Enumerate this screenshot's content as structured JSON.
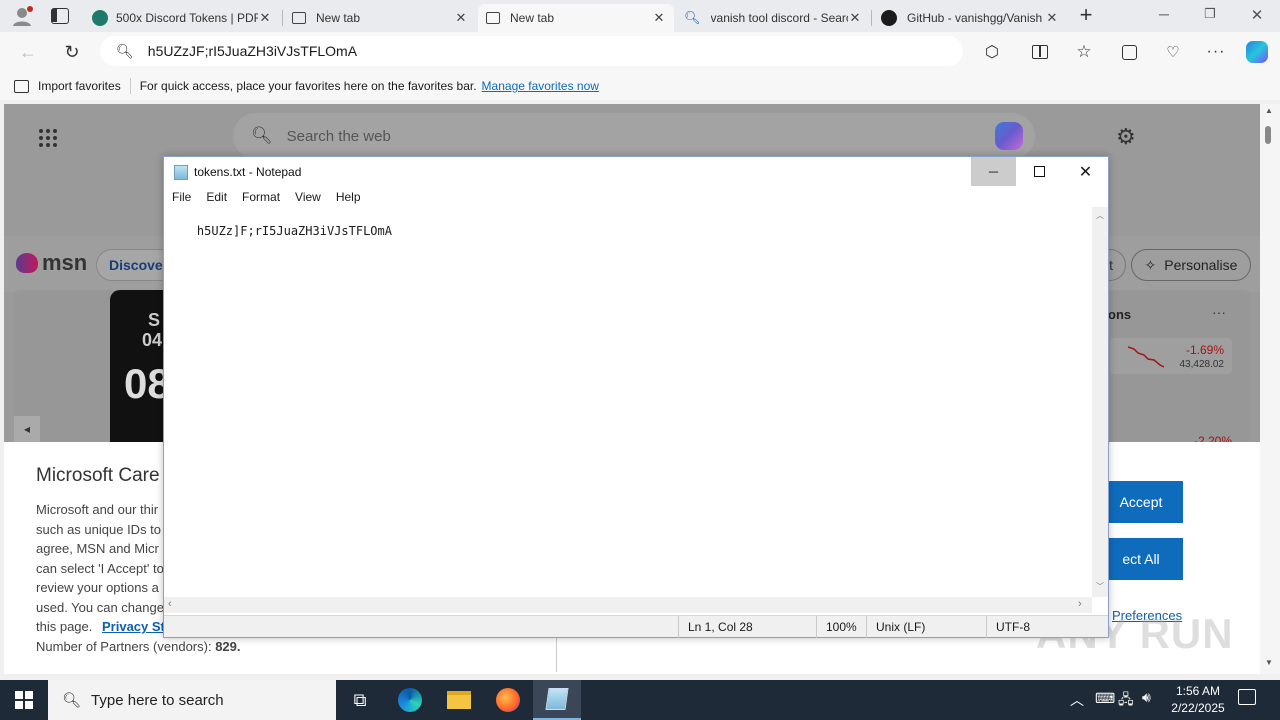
{
  "browser": {
    "tabs": [
      {
        "title": "500x Discord Tokens | PDF",
        "icon": "globe-icon"
      },
      {
        "title": "New tab",
        "icon": "newtab-icon"
      },
      {
        "title": "New tab",
        "icon": "newtab-icon"
      },
      {
        "title": "vanish tool discord - Search",
        "icon": "search-icon"
      },
      {
        "title": "GitHub - vanishgg/Vanish",
        "icon": "github-icon"
      }
    ],
    "address": "h5UZzJF;rI5JuaZH3iVJsTFLOmA",
    "favbar": {
      "import_label": "Import favorites",
      "message": "For quick access, place your favorites here on the favorites bar.",
      "manage_link": "Manage favorites now"
    }
  },
  "msn": {
    "search_placeholder": "Search the web",
    "logo": "msn",
    "discover": "Discover",
    "personalise": "Personalise",
    "widget_title": "ons",
    "stock_change": "-1.69%",
    "stock_value": "43,428.02",
    "stock_change2": "-2.20%",
    "watch_text_1": "S",
    "watch_text_2": "04",
    "watch_text_3": "08"
  },
  "cookie": {
    "title": "Microsoft Care",
    "lines": [
      "Microsoft and our thir",
      "such as unique IDs to",
      "agree, MSN and Micr",
      "can select 'I Accept' to",
      "review your options a",
      "used.  You can change"
    ],
    "last_line_prefix": "this page.",
    "privacy_link": "Privacy Sta",
    "partners_label": "Number of Partners (vendors):",
    "partners_count": "829.",
    "accept_button": "Accept",
    "reject_button": "ect All",
    "preferences_link": "Preferences"
  },
  "notepad": {
    "title": "tokens.txt - Notepad",
    "menu": [
      "File",
      "Edit",
      "Format",
      "View",
      "Help"
    ],
    "content": "h5UZz]F;rI5JuaZH3iVJsTFLOmA",
    "status": {
      "position": "Ln 1, Col 28",
      "zoom": "100%",
      "line_ending": "Unix (LF)",
      "encoding": "UTF-8"
    }
  },
  "taskbar": {
    "search_placeholder": "Type here to search",
    "time": "1:56 AM",
    "date": "2/22/2025"
  },
  "watermark": "ANY RUN"
}
